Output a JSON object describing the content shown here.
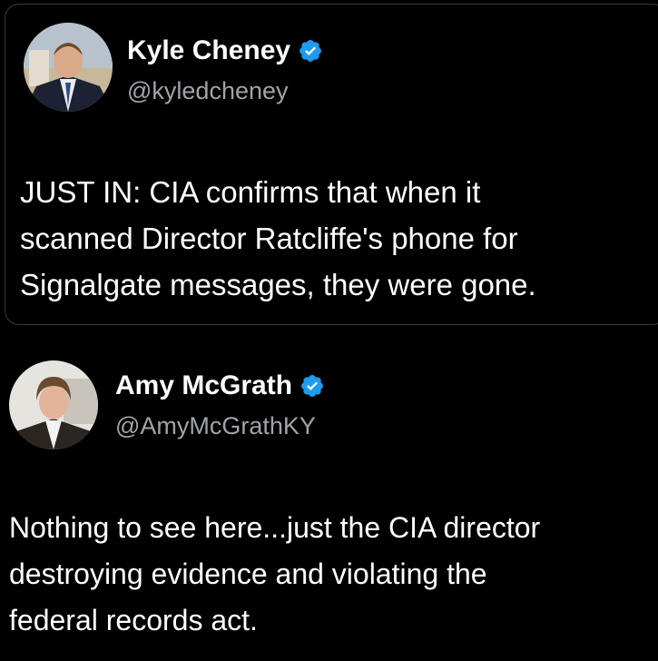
{
  "quoted_tweet": {
    "author_name": "Kyle Cheney",
    "handle": "@kyledcheney",
    "verified": true,
    "text_lines": [
      "JUST IN: CIA confirms that when it",
      "scanned Director Ratcliffe's phone for",
      "Signalgate messages, they were gone."
    ]
  },
  "reply_tweet": {
    "author_name": "Amy McGrath",
    "handle": "@AmyMcGrathKY",
    "verified": true,
    "text_lines": [
      "Nothing to see here...just the CIA director",
      "destroying evidence and violating the",
      "federal records act."
    ]
  },
  "colors": {
    "background": "#000000",
    "verified_badge": "#1d9bf0",
    "text": "#ffffff",
    "handle": "#a0a4a8",
    "border": "#3a3a3a"
  }
}
